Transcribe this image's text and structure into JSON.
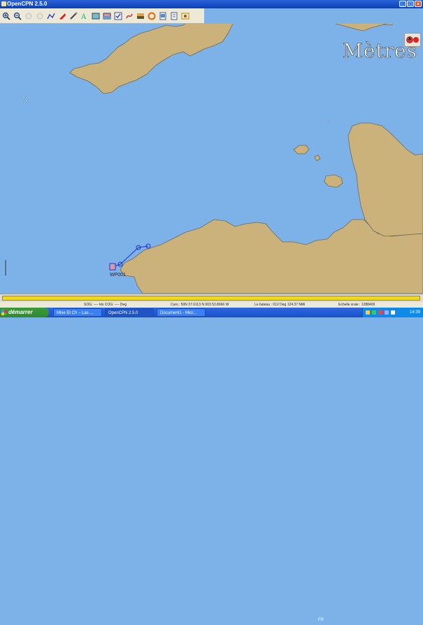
{
  "window": {
    "title": "OpenCPN 2.5.0",
    "buttons": [
      "_",
      "□",
      "×"
    ]
  },
  "toolbar": {
    "icons": [
      "zoom-in-icon",
      "zoom-out-icon",
      "scale-in-icon",
      "scale-out-icon",
      "route-icon",
      "follow-ship-icon",
      "settings-icon",
      "text-icon",
      "chart-stack-icon",
      "chart-quilt-icon",
      "tracking-icon",
      "current-icon",
      "tide-icon",
      "mob-icon",
      "help-icon",
      "print-icon",
      "about-icon"
    ]
  },
  "chart": {
    "units_label": "Mètres",
    "waypoint_label": "WP001"
  },
  "status": {
    "sog": "SOG: ---- kts  COG: ---- Deg",
    "cursor": "Curs.: 50N 37.6113 N 003 53.8666 W",
    "bearing": "Le bateau : 012 Deg  124.37 NMi",
    "scale": "Echelle vraie : 1288400"
  },
  "taskbar": {
    "start": "démarrer",
    "tasks": [
      "Mise Et Ch – Las ...",
      "OpenCPN 2.5.0",
      "Document1 - Micr..."
    ],
    "lang": "FR",
    "clock": "14:39"
  },
  "colors": {
    "sea": "#7db2e8",
    "land": "#cbb27a",
    "coast": "#6e6a58",
    "route": "#2233cc"
  }
}
